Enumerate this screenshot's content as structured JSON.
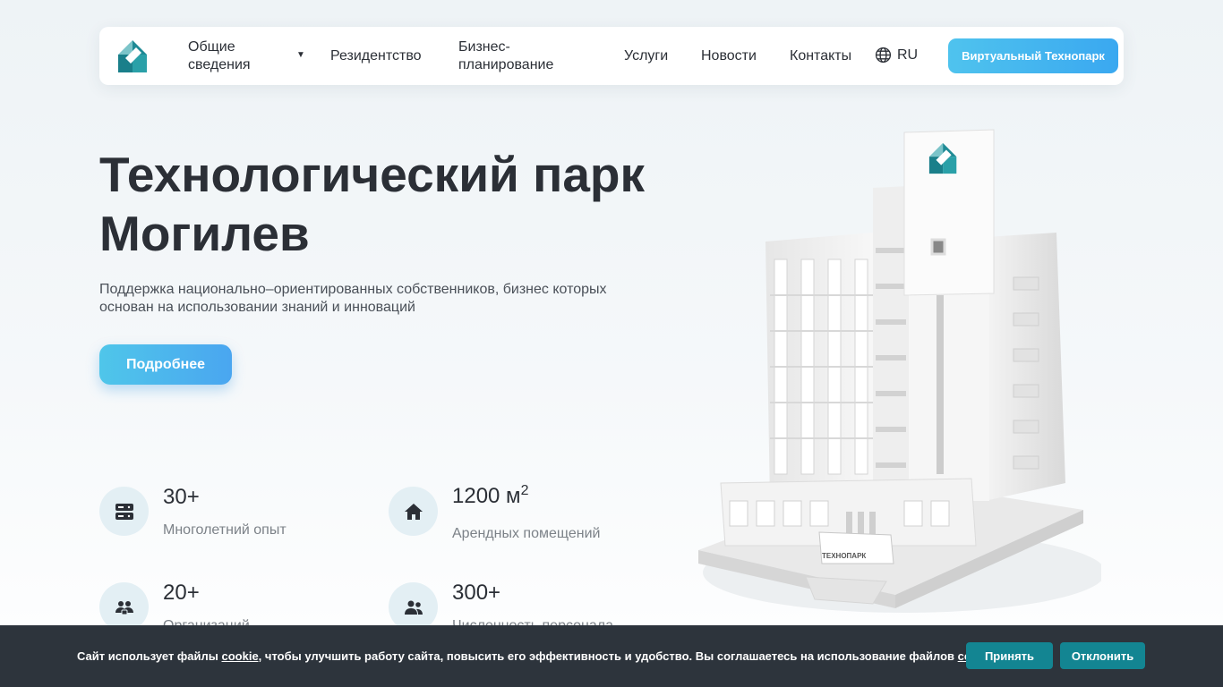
{
  "header": {
    "nav": {
      "general": "Общие сведения",
      "residency": "Резидентство",
      "business_planning": "Бизнес-планирование",
      "services": "Услуги",
      "news": "Новости",
      "contacts": "Контакты"
    },
    "lang": "RU",
    "virtual_label": "Виртуальный Технопарк"
  },
  "hero": {
    "title": "Технологический парк Могилев",
    "description": "Поддержка национально–ориентированных собственников, бизнес которых основан на использовании знаний и инноваций",
    "more_label": "Подробнее"
  },
  "stats": [
    {
      "value": "30+",
      "label": "Многолетний опыт",
      "icon": "server-icon"
    },
    {
      "value": "1200 м",
      "sup": "2",
      "label": "Арендных помещений",
      "icon": "home-icon"
    },
    {
      "value": "20+",
      "label": "Организаций",
      "icon": "organizations-icon"
    },
    {
      "value": "300+",
      "label": "Численность персонала",
      "icon": "people-icon"
    }
  ],
  "building": {
    "sign": "ТЕХНОПАРК"
  },
  "cookie": {
    "text_before": "Сайт использует файлы ",
    "link1": "cookie,",
    "text_middle": " чтобы улучшить работу сайта, повысить его эффективность и удобство. Вы соглашаетесь на использование файлов ",
    "link2": "cookie.",
    "accept": "Принять",
    "decline": "Отклонить"
  },
  "colors": {
    "accent": "#4fc3ee",
    "cookie_bg": "#2d343c",
    "cookie_button": "#138592",
    "logo_teal": "#1e8a95"
  }
}
